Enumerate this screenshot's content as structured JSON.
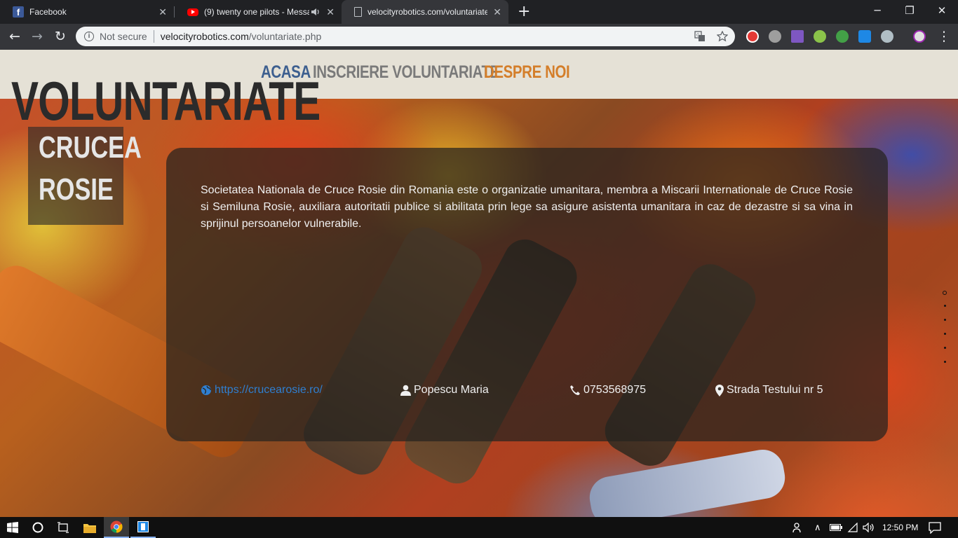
{
  "browser": {
    "tabs": [
      {
        "title": "Facebook",
        "favicon": "facebook-icon"
      },
      {
        "title": "(9) twenty one pilots - Messa",
        "favicon": "youtube-icon",
        "audio": true
      },
      {
        "title": "velocityrobotics.com/voluntariate",
        "favicon": "document-icon",
        "active": true
      }
    ],
    "security_label": "Not secure",
    "url_domain": "velocityrobotics.com",
    "url_path": "/voluntariate.php"
  },
  "site": {
    "nav": [
      {
        "label": "ACASA",
        "color": "#3d5f8f"
      },
      {
        "label": "INSCRIERE VOLUNTARIATE",
        "color": "#7a7a7a"
      },
      {
        "label": "DESPRE NOI",
        "color": "#d47e2a"
      }
    ],
    "title": "VOLUNTARIATE",
    "organization": {
      "name_line1": "CRUCEA",
      "name_line2": "ROSIE",
      "description": "Societatea Nationala de Cruce Rosie din Romania este o organizatie umanitara, membra a Miscarii Internationale de Cruce Rosie si Semiluna Rosie, auxiliara autoritatii publice si abilitata prin lege sa asigure asistenta umanitara in caz de dezastre si sa vina in sprijinul persoanelor vulnerabile.",
      "website": "https://crucearosie.ro/",
      "contact": "Popescu Maria",
      "phone": "0753568975",
      "address": "Strada Testului nr 5"
    }
  },
  "taskbar": {
    "time": "12:50 PM"
  }
}
